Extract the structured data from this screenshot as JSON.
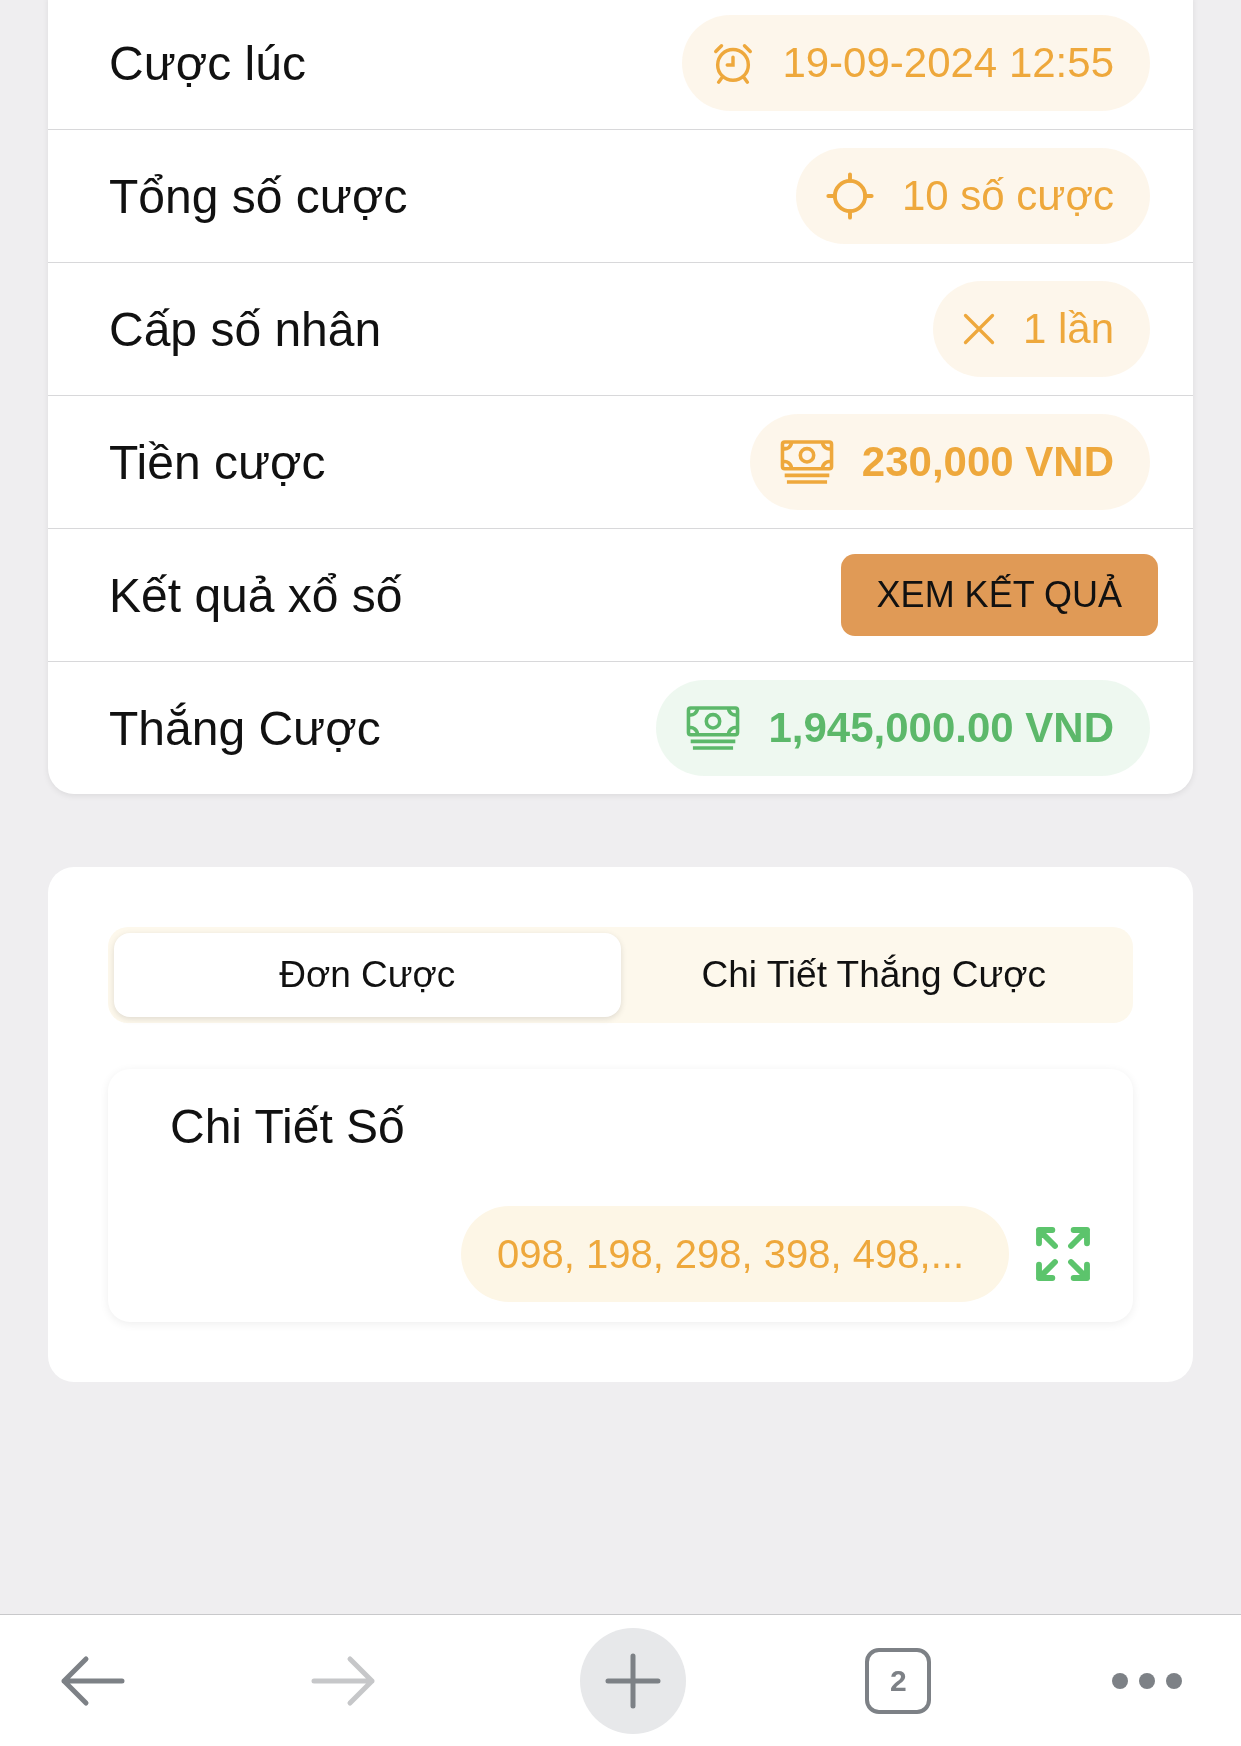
{
  "bet_info": {
    "rows": [
      {
        "kind": "pill",
        "label": "Cược lúc",
        "value": "19-09-2024 12:55",
        "bold": false,
        "color": "#eea83c"
      },
      {
        "kind": "pill",
        "label": "Tổng số cược",
        "value": "10 số cược",
        "bold": false,
        "color": "#eea83c"
      },
      {
        "kind": "pill",
        "label": "Cấp số nhân",
        "value": "1 lần",
        "bold": false,
        "color": "#eea83c"
      },
      {
        "kind": "pill",
        "label": "Tiền cược",
        "value": "230,000 VND",
        "bold": true,
        "color": "#eea83c"
      },
      {
        "kind": "button",
        "label": "Kết quả xổ số",
        "value": "XEM KẾT QUẢ"
      },
      {
        "kind": "pill",
        "label": "Thắng Cược",
        "value": "1,945,000.00 VND",
        "bold": true,
        "color": "#5cb86a"
      }
    ]
  },
  "detail": {
    "tabs": [
      {
        "label": "Đơn Cược",
        "selected": true
      },
      {
        "label": "Chi Tiết Thắng Cược",
        "selected": false
      }
    ],
    "section_title": "Chi Tiết Số",
    "numbers": "098, 198, 298, 398, 498,..."
  },
  "browser_bar": {
    "back_disabled": false,
    "forward_disabled": true,
    "tab_count": "2"
  }
}
